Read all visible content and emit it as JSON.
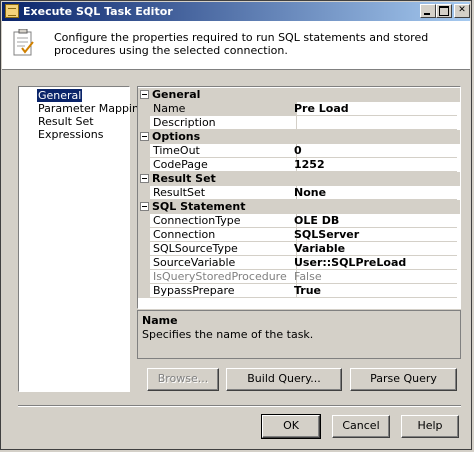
{
  "window": {
    "title": "Execute SQL Task Editor"
  },
  "header": {
    "description": "Configure the properties required to run SQL statements and stored procedures using the selected connection."
  },
  "nav": {
    "items": [
      {
        "label": "General",
        "selected": true
      },
      {
        "label": "Parameter Mapping"
      },
      {
        "label": "Result Set"
      },
      {
        "label": "Expressions"
      }
    ]
  },
  "grid": {
    "general": {
      "label": "General",
      "name_label": "Name",
      "name_value": "Pre Load",
      "description_label": "Description",
      "description_value": ""
    },
    "options": {
      "label": "Options",
      "timeout_label": "TimeOut",
      "timeout_value": "0",
      "codepage_label": "CodePage",
      "codepage_value": "1252"
    },
    "result_set": {
      "label": "Result Set",
      "resultset_label": "ResultSet",
      "resultset_value": "None"
    },
    "sql_statement": {
      "label": "SQL Statement",
      "connectiontype_label": "ConnectionType",
      "connectiontype_value": "OLE DB",
      "connection_label": "Connection",
      "connection_value": "SQLServer",
      "sqlsourcetype_label": "SQLSourceType",
      "sqlsourcetype_value": "Variable",
      "sourcevariable_label": "SourceVariable",
      "sourcevariable_value": "User::SQLPreLoad",
      "isquerystoredprocedure_label": "IsQueryStoredProcedure",
      "isquerystoredprocedure_value": "False",
      "bypassprepare_label": "BypassPrepare",
      "bypassprepare_value": "True"
    }
  },
  "description_panel": {
    "title": "Name",
    "text": "Specifies the name of the task."
  },
  "buttons": {
    "browse": "Browse...",
    "build_query": "Build Query...",
    "parse_query": "Parse Query",
    "ok": "OK",
    "cancel": "Cancel",
    "help": "Help"
  }
}
